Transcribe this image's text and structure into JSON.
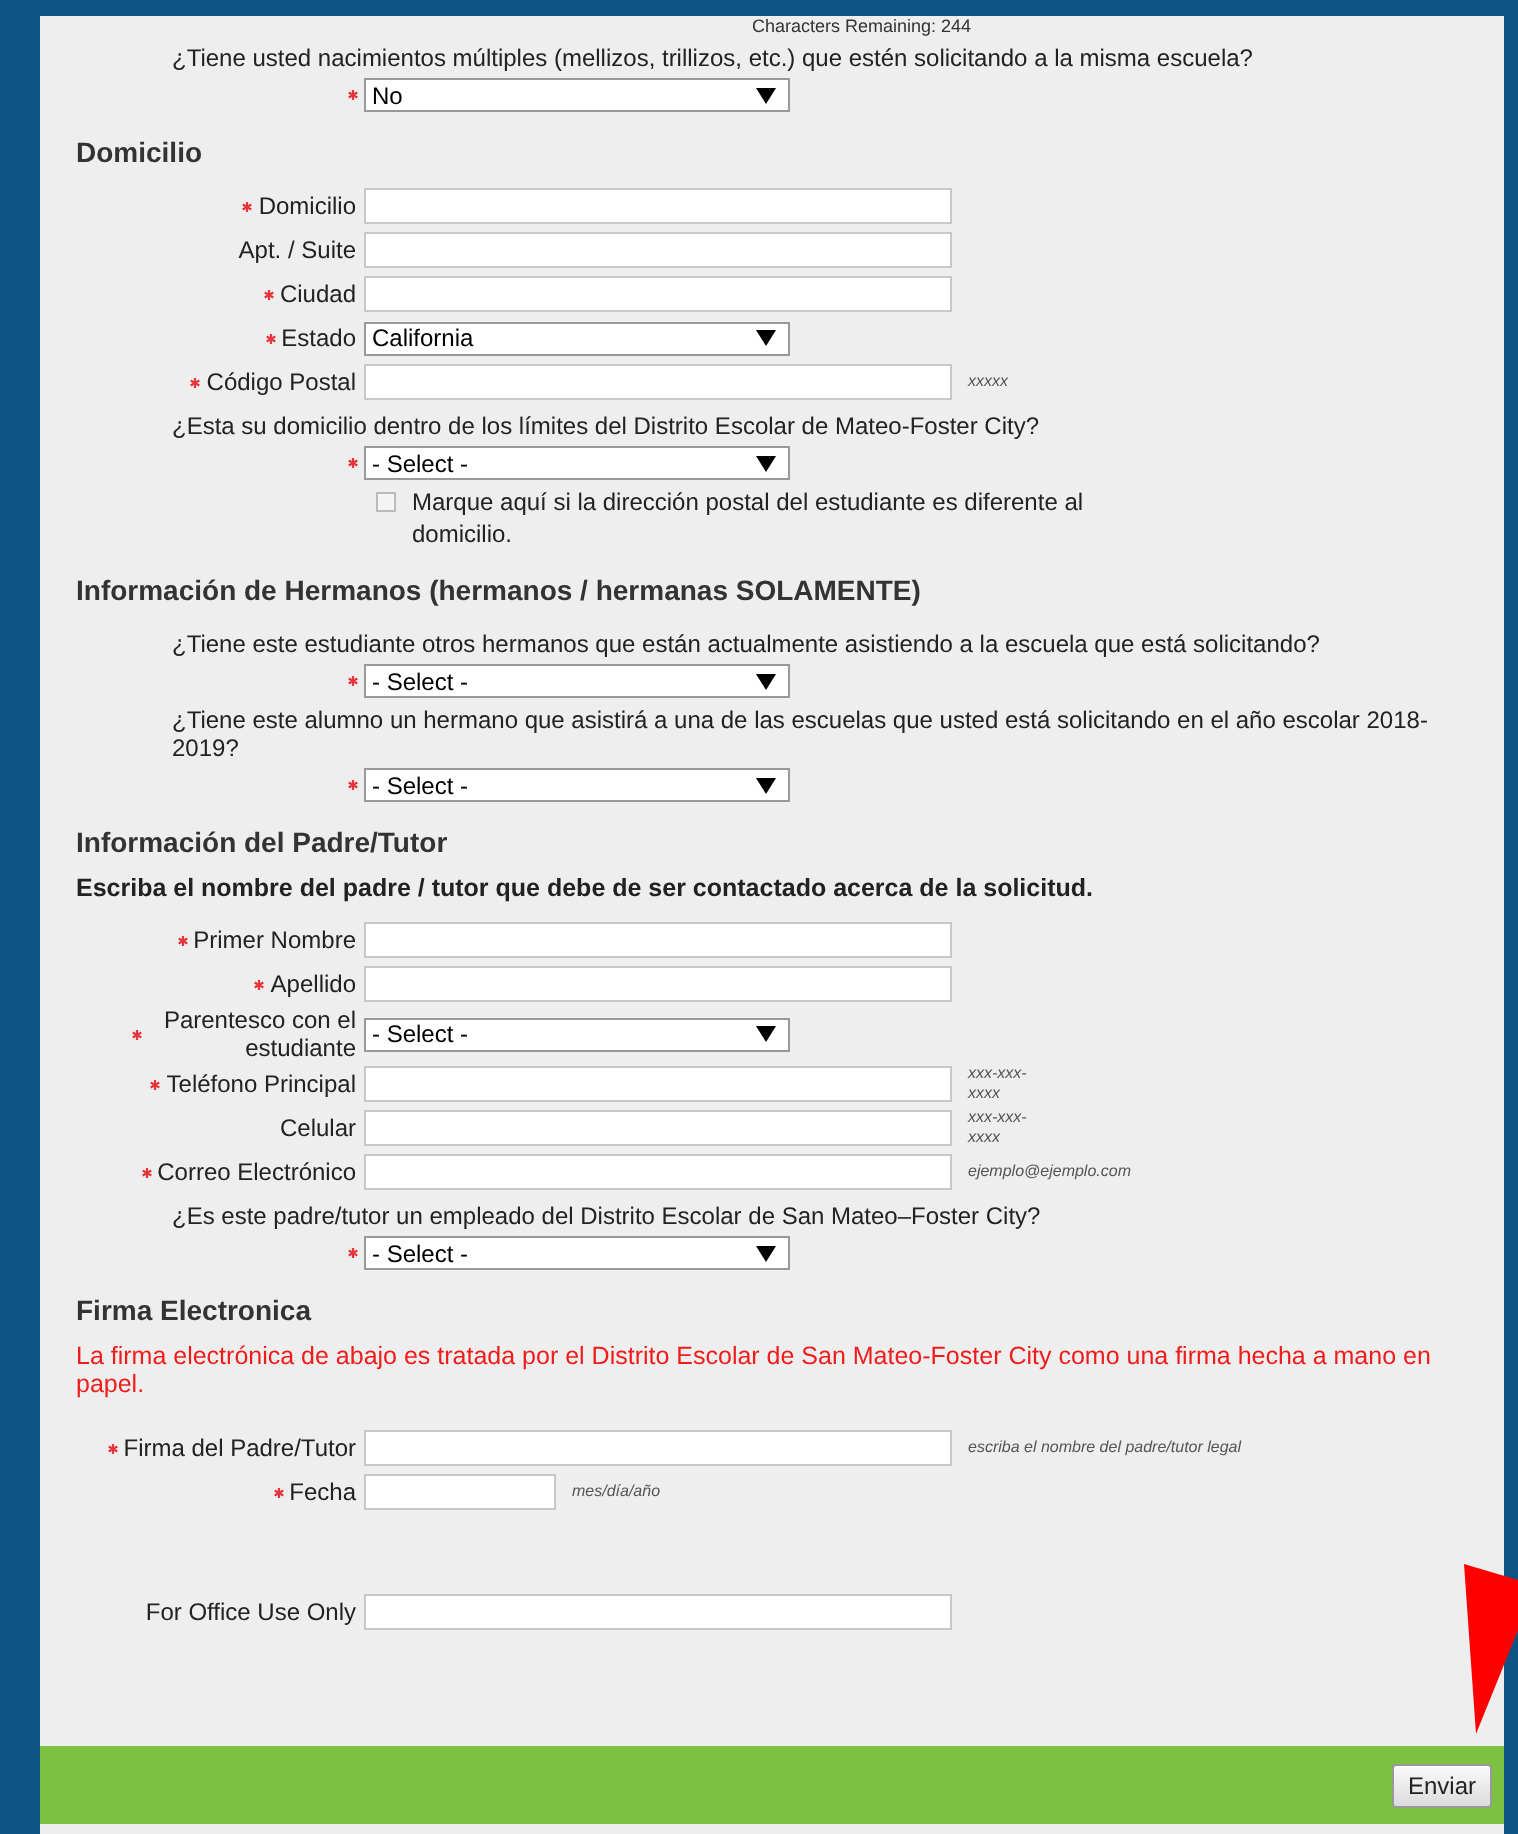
{
  "counter": "Characters Remaining: 244",
  "sections": [
    {
      "items": [
        {
          "kind": "question",
          "text": "¿Tiene usted nacimientos múltiples (mellizos, trillizos, etc.) que estén solicitando a la misma escuela?",
          "required": true,
          "value": "No"
        }
      ]
    },
    {
      "title": "Domicilio",
      "items": [
        {
          "kind": "field",
          "label": "Domicilio",
          "required": true
        },
        {
          "kind": "field",
          "label": "Apt. / Suite",
          "required": false
        },
        {
          "kind": "field",
          "label": "Ciudad",
          "required": true
        },
        {
          "kind": "select",
          "label": "Estado",
          "required": true,
          "value": "California"
        },
        {
          "kind": "field",
          "label": "Código Postal",
          "required": true,
          "hint": "xxxxx"
        },
        {
          "kind": "question",
          "text": "¿Esta su domicilio dentro de los límites del Distrito Escolar de Mateo-Foster City?",
          "required": true,
          "value": "- Select -"
        },
        {
          "kind": "checkbox",
          "label": "Marque aquí si la dirección postal del estudiante es diferente al domicilio.",
          "checked": false
        }
      ]
    },
    {
      "title": "Información de Hermanos (hermanos / hermanas SOLAMENTE)",
      "items": [
        {
          "kind": "question",
          "text": "¿Tiene este estudiante otros hermanos que están actualmente asistiendo a la escuela que está solicitando?",
          "required": true,
          "value": "- Select -"
        },
        {
          "kind": "question",
          "text": "¿Tiene este alumno un hermano que asistirá a una de las escuelas que usted está solicitando en el año escolar 2018-2019?",
          "required": true,
          "value": "- Select -"
        }
      ]
    },
    {
      "title": "Información del Padre/Tutor",
      "items": [
        {
          "kind": "instruction",
          "text": "Escriba el nombre del padre / tutor que debe de ser contactado acerca de la solicitud."
        },
        {
          "kind": "field",
          "label": "Primer Nombre",
          "required": true
        },
        {
          "kind": "field",
          "label": "Apellido",
          "required": true
        },
        {
          "kind": "select",
          "label": "Parentesco con el estudiante",
          "required": true,
          "value": "- Select -"
        },
        {
          "kind": "field",
          "label": "Teléfono Principal",
          "required": true,
          "hint": "xxx-xxx-xxxx"
        },
        {
          "kind": "field",
          "label": "Celular",
          "required": false,
          "hint": "xxx-xxx-xxxx"
        },
        {
          "kind": "field",
          "label": "Correo Electrónico",
          "required": true,
          "hint": "ejemplo@ejemplo.com"
        },
        {
          "kind": "question",
          "text": "¿Es este padre/tutor un empleado del Distrito Escolar de San Mateo–Foster City?",
          "required": true,
          "value": "- Select -"
        }
      ]
    },
    {
      "title": "Firma Electronica",
      "items": [
        {
          "kind": "notice",
          "text": "La firma electrónica de abajo es tratada por el Distrito Escolar de San Mateo-Foster City como una firma hecha a mano en papel."
        },
        {
          "kind": "field",
          "label": "Firma del Padre/Tutor",
          "required": true,
          "hint": "escriba el nombre del padre/tutor legal"
        },
        {
          "kind": "date",
          "label": "Fecha",
          "required": true,
          "hint": "mes/día/año"
        }
      ]
    },
    {
      "items": [
        {
          "kind": "field",
          "label": "For Office Use Only",
          "required": false
        }
      ]
    }
  ],
  "submit": "Enviar"
}
